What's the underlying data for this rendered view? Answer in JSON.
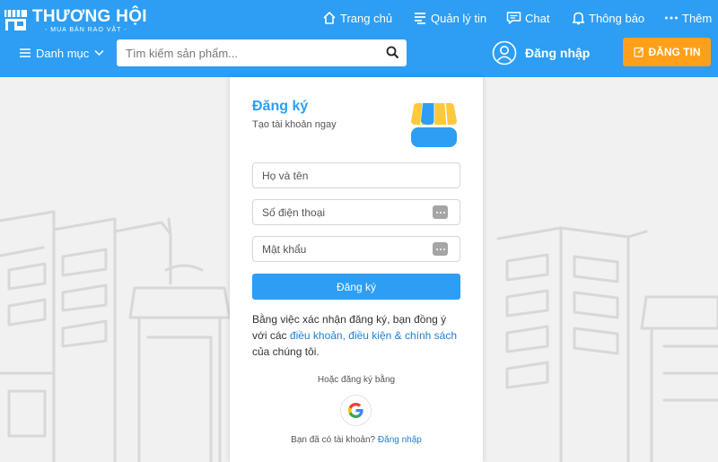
{
  "header": {
    "logo_title": "THƯƠNG HỘI",
    "logo_subtitle": "- MUA BÁN RAO VẶT -",
    "nav": [
      {
        "label": "Trang chủ",
        "icon": "home-icon"
      },
      {
        "label": "Quản lý tin",
        "icon": "manage-icon"
      },
      {
        "label": "Chat",
        "icon": "chat-icon"
      },
      {
        "label": "Thông báo",
        "icon": "bell-icon"
      },
      {
        "label": "Thêm",
        "icon": "more-icon"
      }
    ],
    "category_label": "Danh mục",
    "search_placeholder": "Tìm kiếm sản phẩm...",
    "login_label": "Đăng nhập",
    "post_label": "ĐĂNG TIN"
  },
  "form": {
    "title": "Đăng ký",
    "subtitle": "Tạo tài khoản ngay",
    "name_placeholder": "Họ và tên",
    "phone_placeholder": "Số điện thoại",
    "password_placeholder": "Mật khẩu",
    "submit_label": "Đăng ký",
    "terms_prefix": "Bằng việc xác nhận đăng ký, bạn đồng ý với các",
    "terms_link": "điều khoản, điều kiện & chính sách",
    "terms_suffix": "của chúng tôi.",
    "alt_label": "Hoặc đăng ký bằng",
    "have_account": "Bạn đã có tài khoản?",
    "login_link": "Đăng nhập"
  },
  "colors": {
    "primary": "#2d9ef3",
    "accent": "#ff9f1a",
    "link": "#1f7fd1"
  }
}
